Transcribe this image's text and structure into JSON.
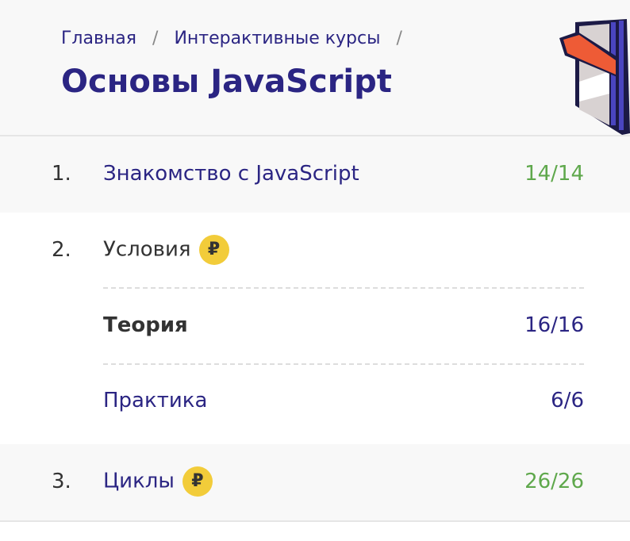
{
  "breadcrumb": [
    "Главная",
    "Интерактивные курсы"
  ],
  "page_title": "Основы JavaScript",
  "lessons": [
    {
      "num": "1.",
      "title": "Знакомство с JavaScript",
      "count": "14/14"
    },
    {
      "num": "2.",
      "title": "Условия",
      "badge": "₽",
      "sub": [
        {
          "title": "Теория",
          "count": "16/16"
        },
        {
          "title": "Практика",
          "count": "6/6"
        }
      ]
    },
    {
      "num": "3.",
      "title": "Циклы",
      "badge": "₽",
      "count": "26/26"
    }
  ],
  "colors": {
    "accent": "#2b2583",
    "done": "#5fa84c",
    "badge": "#f2cc3a"
  }
}
